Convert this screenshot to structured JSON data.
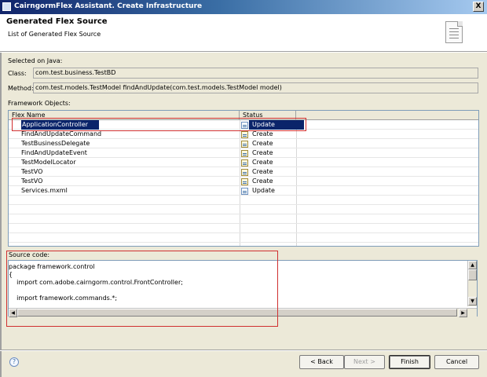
{
  "window": {
    "title": "CairngormFlex Assistant. Create Infrastructure",
    "close_label": "X"
  },
  "header": {
    "title": "Generated Flex Source",
    "description": "List of Generated Flex Source"
  },
  "selected": {
    "section_label": "Selected on Java:",
    "class_label": "Class:",
    "class_value": "com.test.business.TestBD",
    "method_label": "Method:",
    "method_value": "com.test.models.TestModel findAndUpdate(com.test.models.TestModel model)"
  },
  "framework": {
    "section_label": "Framework Objects:",
    "columns": [
      "Flex Name",
      "Status"
    ],
    "rows": [
      {
        "name": "ApplicationController",
        "status": "Update",
        "selected": true
      },
      {
        "name": "FindAndUpdateCommand",
        "status": "Create"
      },
      {
        "name": "TestBusinessDelegate",
        "status": "Create"
      },
      {
        "name": "FindAndUpdateEvent",
        "status": "Create"
      },
      {
        "name": "TestModelLocator",
        "status": "Create"
      },
      {
        "name": "TestVO",
        "status": "Create"
      },
      {
        "name": "TestVO",
        "status": "Create"
      },
      {
        "name": "Services.mxml",
        "status": "Update"
      }
    ]
  },
  "source": {
    "label": "Source code:",
    "lines": [
      "package framework.control",
      "{",
      "    import com.adobe.cairngorm.control.FrontController;",
      "",
      "    import framework.commands.*;"
    ]
  },
  "buttons": {
    "help": "?",
    "back": "< Back",
    "next": "Next >",
    "finish": "Finish",
    "cancel": "Cancel"
  }
}
